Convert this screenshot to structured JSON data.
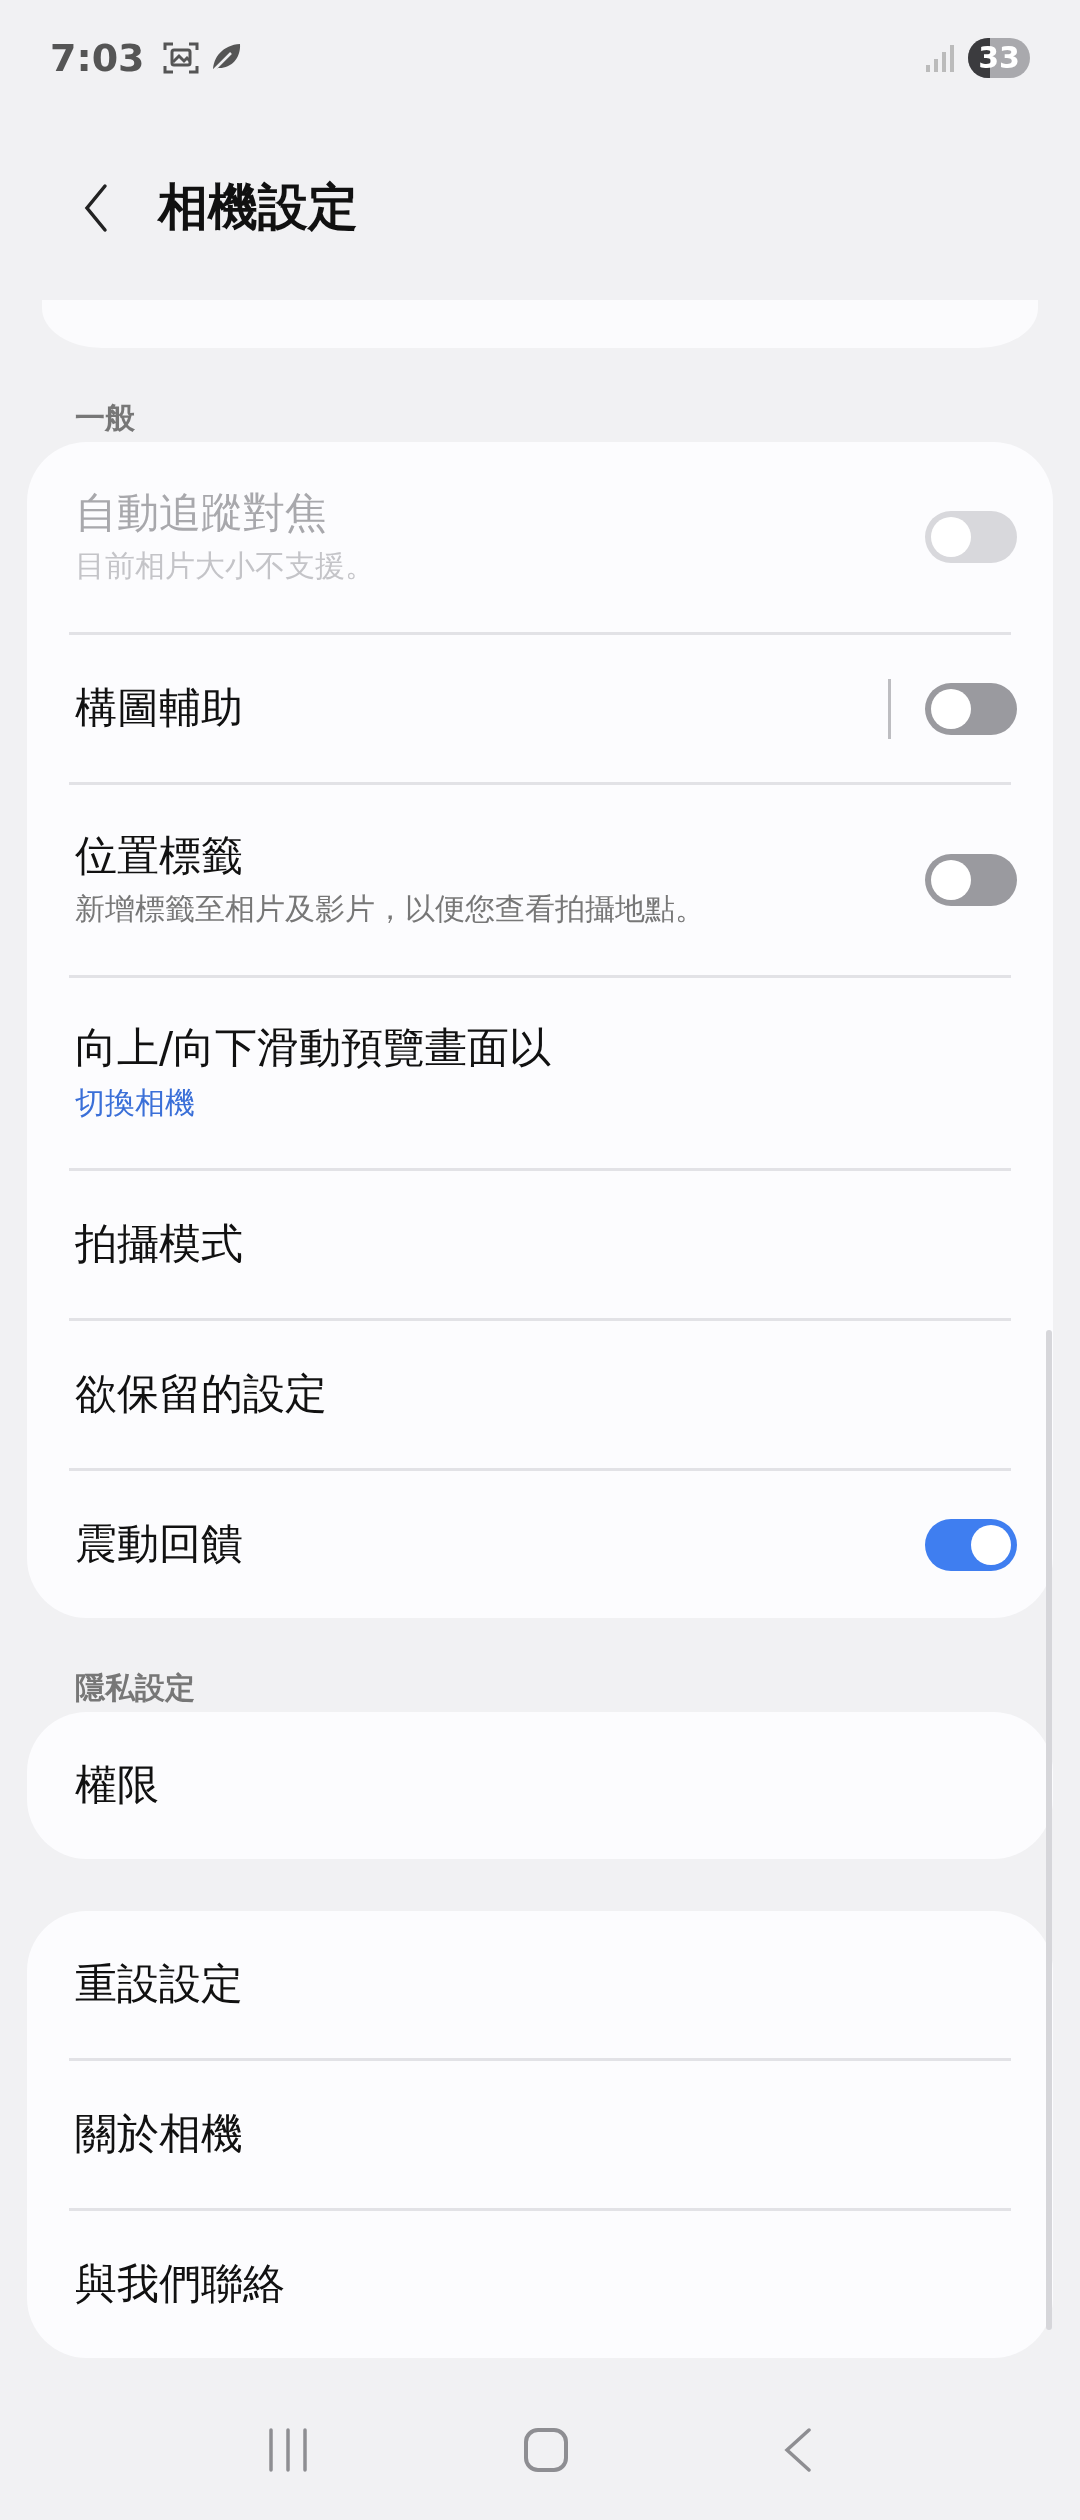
{
  "status_bar": {
    "time": "7:03",
    "battery": "33"
  },
  "header": {
    "title": "相機設定"
  },
  "sections": [
    {
      "header": "一般",
      "items": [
        {
          "title": "自動追蹤對焦",
          "summary": "目前相片大小不支援。",
          "kind": "switch",
          "on": false,
          "disabled": true,
          "split": false
        },
        {
          "title": "構圖輔助",
          "kind": "switch",
          "on": false,
          "disabled": false,
          "split": true
        },
        {
          "title": "位置標籤",
          "summary": "新增標籤至相片及影片，以便您查看拍攝地點。",
          "kind": "switch",
          "on": false,
          "disabled": false,
          "split": false
        },
        {
          "title": "向上/向下滑動預覽畫面以",
          "value": "切換相機",
          "kind": "plain",
          "disabled": false,
          "split": false
        },
        {
          "title": "拍攝模式",
          "kind": "plain",
          "disabled": false,
          "split": false
        },
        {
          "title": "欲保留的設定",
          "kind": "plain",
          "disabled": false,
          "split": false
        },
        {
          "title": "震動回饋",
          "kind": "switch",
          "on": true,
          "disabled": false,
          "split": false
        }
      ]
    },
    {
      "header": "隱私設定",
      "items": [
        {
          "title": "權限",
          "kind": "plain",
          "disabled": false,
          "split": false
        }
      ]
    },
    {
      "items": [
        {
          "title": "重設設定",
          "kind": "plain",
          "disabled": false,
          "split": false
        },
        {
          "title": "關於相機",
          "kind": "plain",
          "disabled": false,
          "split": false
        },
        {
          "title": "與我們聯絡",
          "kind": "plain",
          "disabled": false,
          "split": false
        }
      ]
    }
  ]
}
